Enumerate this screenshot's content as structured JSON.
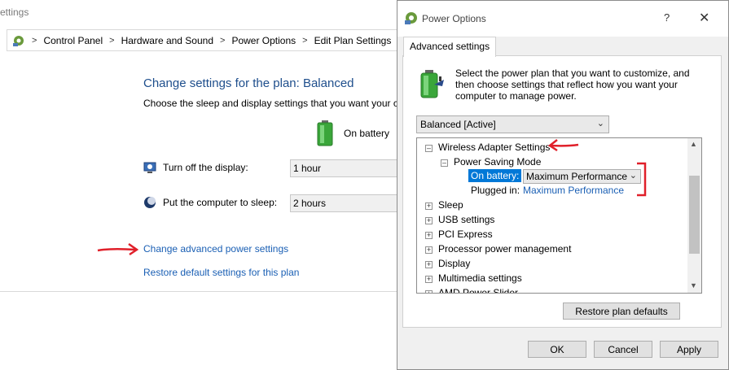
{
  "background_window": {
    "title_fragment": "ettings",
    "breadcrumb": [
      "Control Panel",
      "Hardware and Sound",
      "Power Options",
      "Edit Plan Settings"
    ],
    "heading": "Change settings for the plan: Balanced",
    "subheading": "Choose the sleep and display settings that you want your co",
    "column_header": "On battery",
    "display_label": "Turn off the display:",
    "display_value": "1 hour",
    "sleep_label": "Put the computer to sleep:",
    "sleep_value": "2 hours",
    "advanced_link": "Change advanced power settings",
    "restore_link": "Restore default settings for this plan"
  },
  "dialog": {
    "title": "Power Options",
    "help_glyph": "?",
    "close_glyph": "✕",
    "tab_label": "Advanced settings",
    "description": "Select the power plan that you want to customize, and then choose settings that reflect how you want your computer to manage power.",
    "plan_select_value": "Balanced [Active]",
    "tree": {
      "wireless": "Wireless Adapter Settings",
      "power_saving": "Power Saving Mode",
      "on_battery_label": "On battery:",
      "on_battery_value": "Maximum Performance",
      "plugged_in_label": "Plugged in:",
      "plugged_in_value": "Maximum Performance",
      "items": [
        "Sleep",
        "USB settings",
        "PCI Express",
        "Processor power management",
        "Display",
        "Multimedia settings",
        "AMD Power Slider"
      ]
    },
    "restore_button": "Restore plan defaults",
    "ok_button": "OK",
    "cancel_button": "Cancel",
    "apply_button": "Apply"
  },
  "colors": {
    "link_blue": "#1a5fb4",
    "heading_blue": "#1e4e8c",
    "selection_blue": "#0078d7",
    "annotation_red": "#e0202a"
  }
}
